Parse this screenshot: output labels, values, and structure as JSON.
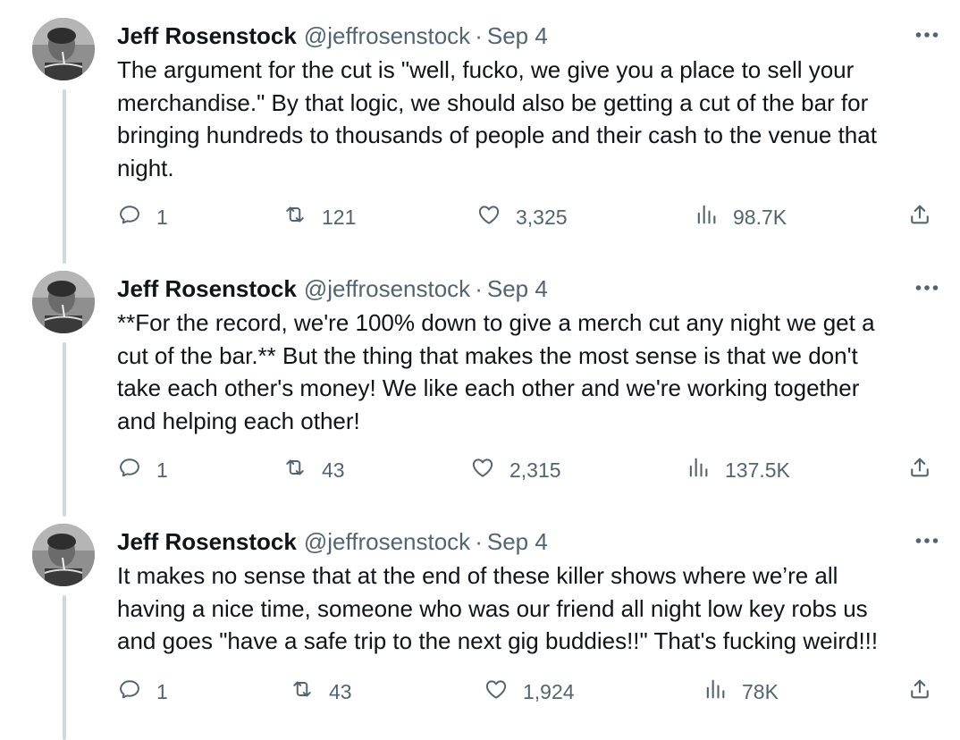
{
  "tweets": [
    {
      "author_name": "Jeff Rosenstock",
      "handle": "@jeffrosenstock",
      "separator": "·",
      "date": "Sep 4",
      "text": "The argument for the cut is \"well, fucko, we give you a place to sell your\nmerchandise.\" By that logic, we should also be getting a cut of the bar for\nbringing hundreds to thousands of people and their cash to the venue that\nnight.",
      "replies": "1",
      "retweets": "121",
      "likes": "3,325",
      "views": "98.7K"
    },
    {
      "author_name": "Jeff Rosenstock",
      "handle": "@jeffrosenstock",
      "separator": "·",
      "date": "Sep 4",
      "text": "**For the record, we're 100% down to give a merch cut any night we get a\ncut of the bar.** But the thing that makes the most sense is that we don't\ntake each other's money! We like each other and we're working together\nand helping each other!",
      "replies": "1",
      "retweets": "43",
      "likes": "2,315",
      "views": "137.5K"
    },
    {
      "author_name": "Jeff Rosenstock",
      "handle": "@jeffrosenstock",
      "separator": "·",
      "date": "Sep 4",
      "text": "It makes no sense that at the end of these killer shows where we’re all\nhaving a nice time, someone who was our friend all night low key robs us\nand goes \"have a safe trip to the next gig buddies!!\" That's fucking weird!!!",
      "replies": "1",
      "retweets": "43",
      "likes": "1,924",
      "views": "78K"
    }
  ],
  "icons": {
    "avatar": "avatar-photo",
    "more": "more-options-icon",
    "reply": "reply-icon",
    "retweet": "retweet-icon",
    "like": "heart-icon",
    "views": "views-chart-icon",
    "share": "share-icon"
  },
  "colors": {
    "text": "#0f1419",
    "secondary": "#536471",
    "thread_line": "#cfd9de",
    "background": "#ffffff"
  }
}
